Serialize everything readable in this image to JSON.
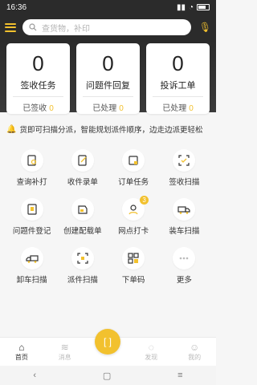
{
  "statusbar": {
    "time": "16:36"
  },
  "search": {
    "placeholder": "查货物，补印"
  },
  "cards": [
    {
      "count": "0",
      "title": "签收任务",
      "sub_label": "已签收",
      "sub_value": "0"
    },
    {
      "count": "0",
      "title": "问题件回复",
      "sub_label": "已处理",
      "sub_value": "0"
    },
    {
      "count": "0",
      "title": "投诉工单",
      "sub_label": "已处理",
      "sub_value": "0"
    }
  ],
  "notice": {
    "text": "货即可扫描分派，智能规划派件顺序，边走边派更轻松"
  },
  "grid": [
    {
      "label": "查询补打",
      "icon": "search-doc-icon"
    },
    {
      "label": "收件录单",
      "icon": "edit-doc-icon"
    },
    {
      "label": "订单任务",
      "icon": "order-icon"
    },
    {
      "label": "签收扫描",
      "icon": "sign-scan-icon"
    },
    {
      "label": "问题件登记",
      "icon": "problem-doc-icon"
    },
    {
      "label": "创建配载单",
      "icon": "stowage-icon"
    },
    {
      "label": "网点打卡",
      "icon": "checkin-icon",
      "badge": "3"
    },
    {
      "label": "装车扫描",
      "icon": "truck-load-icon"
    },
    {
      "label": "卸车扫描",
      "icon": "truck-unload-icon"
    },
    {
      "label": "派件扫描",
      "icon": "dispatch-scan-icon"
    },
    {
      "label": "下单码",
      "icon": "qr-icon"
    },
    {
      "label": "更多",
      "icon": "more-icon"
    }
  ],
  "bottom_nav": [
    {
      "label": "首页",
      "icon": "home-icon"
    },
    {
      "label": "消息",
      "icon": "message-icon"
    },
    {
      "label": "发现",
      "icon": "discover-icon"
    },
    {
      "label": "我的",
      "icon": "user-icon"
    }
  ],
  "colors": {
    "accent": "#f2c12e",
    "dark": "#2b2b2b"
  }
}
